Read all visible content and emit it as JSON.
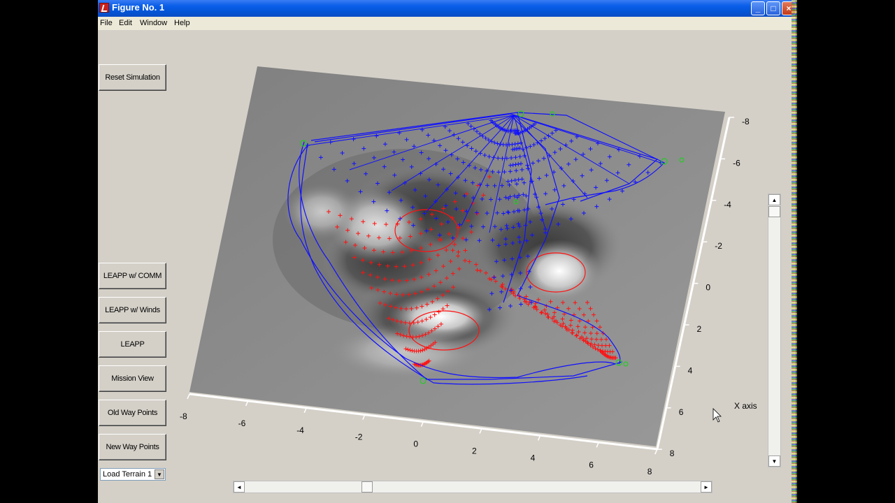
{
  "window": {
    "title": "Figure No. 1",
    "controls": {
      "minimize": "_",
      "maximize": "□",
      "close": "×"
    }
  },
  "menu": [
    "File",
    "Edit",
    "Window",
    "Help"
  ],
  "buttons": {
    "reset": "Reset Simulation",
    "leapp_comm": "LEAPP w/ COMM",
    "leapp_winds": "LEAPP w/ Winds",
    "leapp": "LEAPP",
    "mission_view": "Mission View",
    "old_waypoints": "Old Way Points",
    "new_waypoints": "New Way Points"
  },
  "terrain_select": {
    "value": "Load Terrain 1",
    "arrow": "▼"
  },
  "plot": {
    "x_axis_label": "X axis",
    "y_ticks": [
      "-8",
      "-6",
      "-4",
      "-2",
      "0",
      "2",
      "4",
      "6",
      "8"
    ],
    "x_ticks": [
      "-8",
      "-6",
      "-4",
      "-2",
      "0",
      "2",
      "4",
      "6",
      "8"
    ],
    "colors": {
      "path_a": "#1010ff",
      "path_b": "#ff1010",
      "waypoints": "#22cc22",
      "surface": "#8a8a8a"
    }
  },
  "scrollbars": {
    "left": "◄",
    "right": "►",
    "up": "▲",
    "down": "▼"
  }
}
